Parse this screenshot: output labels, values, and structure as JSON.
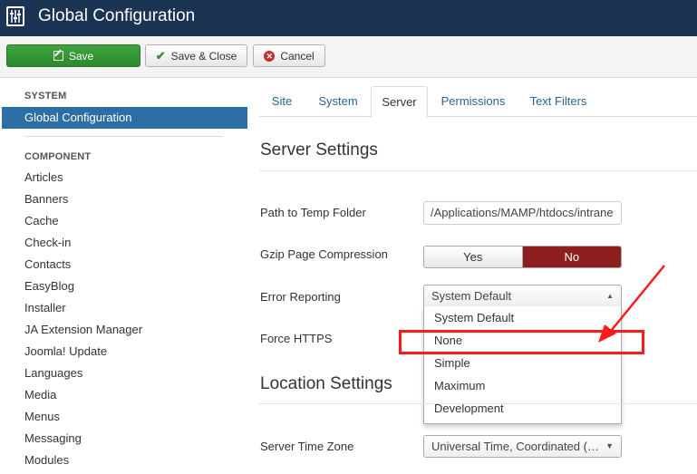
{
  "header": {
    "title": "Global Configuration",
    "icon": "sliders-icon"
  },
  "toolbar": {
    "save_label": "Save",
    "save_close_label": "Save & Close",
    "cancel_label": "Cancel",
    "save_color": "#34963a"
  },
  "sidebar": {
    "system_heading": "SYSTEM",
    "active_item": "Global Configuration",
    "component_heading": "COMPONENT",
    "items": [
      "Articles",
      "Banners",
      "Cache",
      "Check-in",
      "Contacts",
      "EasyBlog",
      "Installer",
      "JA Extension Manager",
      "Joomla! Update",
      "Languages",
      "Media",
      "Menus",
      "Messaging",
      "Modules"
    ]
  },
  "tabs": [
    "Site",
    "System",
    "Server",
    "Permissions",
    "Text Filters"
  ],
  "active_tab": "Server",
  "server": {
    "title": "Server Settings",
    "temp_label": "Path to Temp Folder",
    "temp_value": "/Applications/MAMP/htdocs/intrane",
    "gzip_label": "Gzip Page Compression",
    "gzip_yes": "Yes",
    "gzip_no": "No",
    "gzip_selected": "No",
    "error_label": "Error Reporting",
    "error_value": "System Default",
    "error_options": [
      "System Default",
      "None",
      "Simple",
      "Maximum",
      "Development"
    ],
    "https_label": "Force HTTPS"
  },
  "location": {
    "title": "Location Settings",
    "tz_label": "Server Time Zone",
    "tz_value": "Universal Time, Coordinated (UTC)"
  },
  "annotation": {
    "highlighted_option": "None",
    "color": "#ff1a1a"
  }
}
